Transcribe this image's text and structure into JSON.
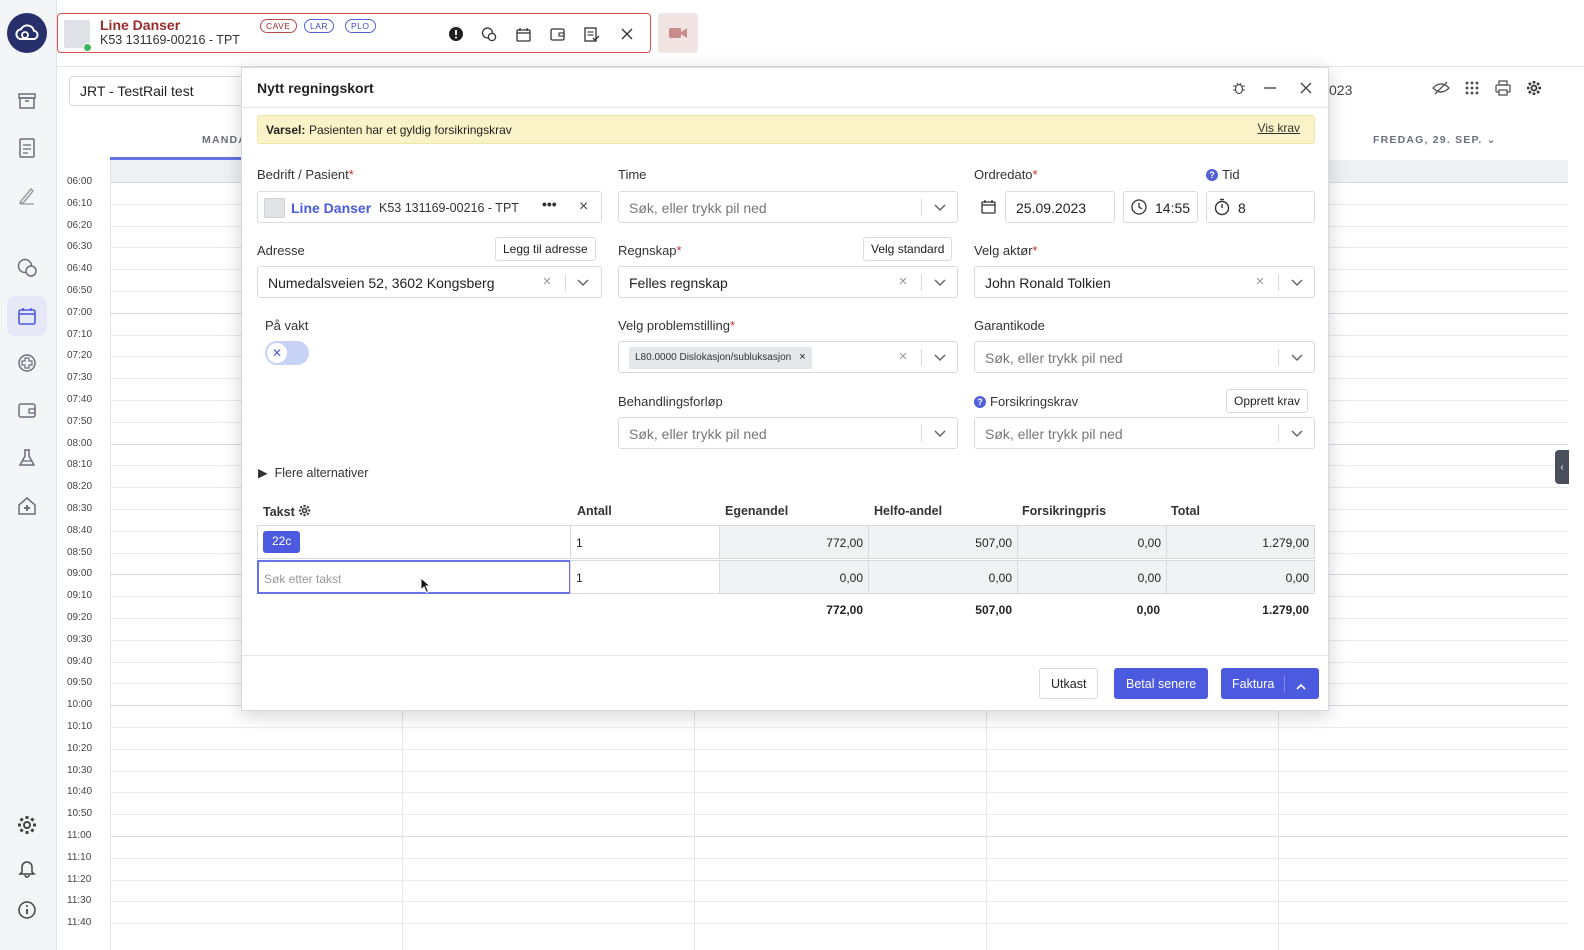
{
  "patient_bar": {
    "name": "Line Danser",
    "id": "K53 131169-00216 - TPT",
    "tags": [
      "CAVE",
      "LAR",
      "PLO"
    ]
  },
  "calendar": {
    "selector_value": "JRT - TestRail test",
    "left_day": "MANDA",
    "right_day": "FREDAG, 29. SEP.",
    "partial_year": "023",
    "times": [
      "06:00",
      "06:10",
      "06:20",
      "06:30",
      "06:40",
      "06:50",
      "07:00",
      "07:10",
      "07:20",
      "07:30",
      "07:40",
      "07:50",
      "08:00",
      "08:10",
      "08:20",
      "08:30",
      "08:40",
      "08:50",
      "09:00",
      "09:10",
      "09:20",
      "09:30",
      "09:40",
      "09:50",
      "10:00",
      "10:10",
      "10:20",
      "10:30",
      "10:40",
      "10:50",
      "11:00",
      "11:10",
      "11:20",
      "11:30",
      "11:40"
    ]
  },
  "modal": {
    "title": "Nytt regningskort",
    "alert": {
      "label": "Varsel:",
      "text": "Pasienten har et gyldig forsikringskrav",
      "link": "Vis krav"
    },
    "fields": {
      "patient": {
        "label": "Bedrift / Pasient",
        "name": "Line Danser",
        "id": "K53 131169-00216 - TPT"
      },
      "time": {
        "label": "Time",
        "placeholder": "Søk, eller trykk pil ned"
      },
      "order_date": {
        "label": "Ordredato",
        "date": "25.09.2023",
        "clock": "14:55"
      },
      "duration": {
        "label": "Tid",
        "value": "8"
      },
      "address": {
        "label": "Adresse",
        "button": "Legg til adresse",
        "value": "Numedalsveien 52, 3602 Kongsberg"
      },
      "account": {
        "label": "Regnskap",
        "button": "Velg standard",
        "value": "Felles regnskap"
      },
      "actor": {
        "label": "Velg aktør",
        "value": "John Ronald Tolkien"
      },
      "on_call": {
        "label": "På vakt"
      },
      "problem": {
        "label": "Velg problemstilling",
        "chip": "L80.0000 Dislokasjon/subluksasjon"
      },
      "warranty": {
        "label": "Garantikode",
        "placeholder": "Søk, eller trykk pil ned"
      },
      "treatment": {
        "label": "Behandlingsforløp",
        "placeholder": "Søk, eller trykk pil ned"
      },
      "insurance": {
        "label": "Forsikringskrav",
        "button": "Opprett krav",
        "placeholder": "Søk, eller trykk pil ned"
      }
    },
    "more_options": "Flere alternativer",
    "table": {
      "headers": [
        "Takst",
        "Antall",
        "Egenandel",
        "Helfo-andel",
        "Forsikringpris",
        "Total"
      ],
      "rows": [
        {
          "code": "22c",
          "antall": "1",
          "egenandel": "772,00",
          "helfo": "507,00",
          "forsikring": "0,00",
          "total": "1.279,00"
        },
        {
          "placeholder": "Søk etter takst",
          "antall": "1",
          "egenandel": "0,00",
          "helfo": "0,00",
          "forsikring": "0,00",
          "total": "0,00"
        }
      ],
      "totals": {
        "egenandel": "772,00",
        "helfo": "507,00",
        "forsikring": "0,00",
        "total": "1.279,00"
      }
    },
    "buttons": {
      "draft": "Utkast",
      "pay_later": "Betal senere",
      "invoice": "Faktura"
    }
  }
}
